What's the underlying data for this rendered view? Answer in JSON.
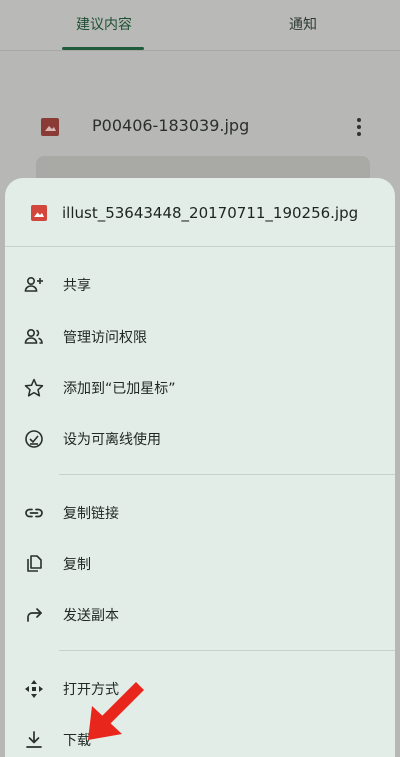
{
  "tabs": [
    {
      "label": "建议内容",
      "active": true
    },
    {
      "label": "通知",
      "active": false
    }
  ],
  "background_file": {
    "name": "P00406-183039.jpg",
    "icon": "image-icon",
    "more_icon": "more-vert-icon"
  },
  "sheet": {
    "title": "illust_53643448_20170711_190256.jpg",
    "title_icon": "image-icon",
    "items": [
      {
        "label": "共享",
        "icon": "person-add-icon"
      },
      {
        "label": "管理访问权限",
        "icon": "people-icon"
      },
      {
        "label": "添加到“已加星标”",
        "icon": "star-icon"
      },
      {
        "label": "设为可离线使用",
        "icon": "offline-check-icon"
      },
      {
        "label": "复制链接",
        "icon": "link-icon"
      },
      {
        "label": "复制",
        "icon": "copy-icon"
      },
      {
        "label": "发送副本",
        "icon": "forward-icon"
      },
      {
        "label": "打开方式",
        "icon": "open-with-icon"
      },
      {
        "label": "下载",
        "icon": "download-icon"
      }
    ]
  },
  "colors": {
    "accent": "#1f5d3a",
    "sheet_bg": "#e1ede6",
    "image_icon": "#d2463c",
    "arrow": "#e8261c"
  }
}
